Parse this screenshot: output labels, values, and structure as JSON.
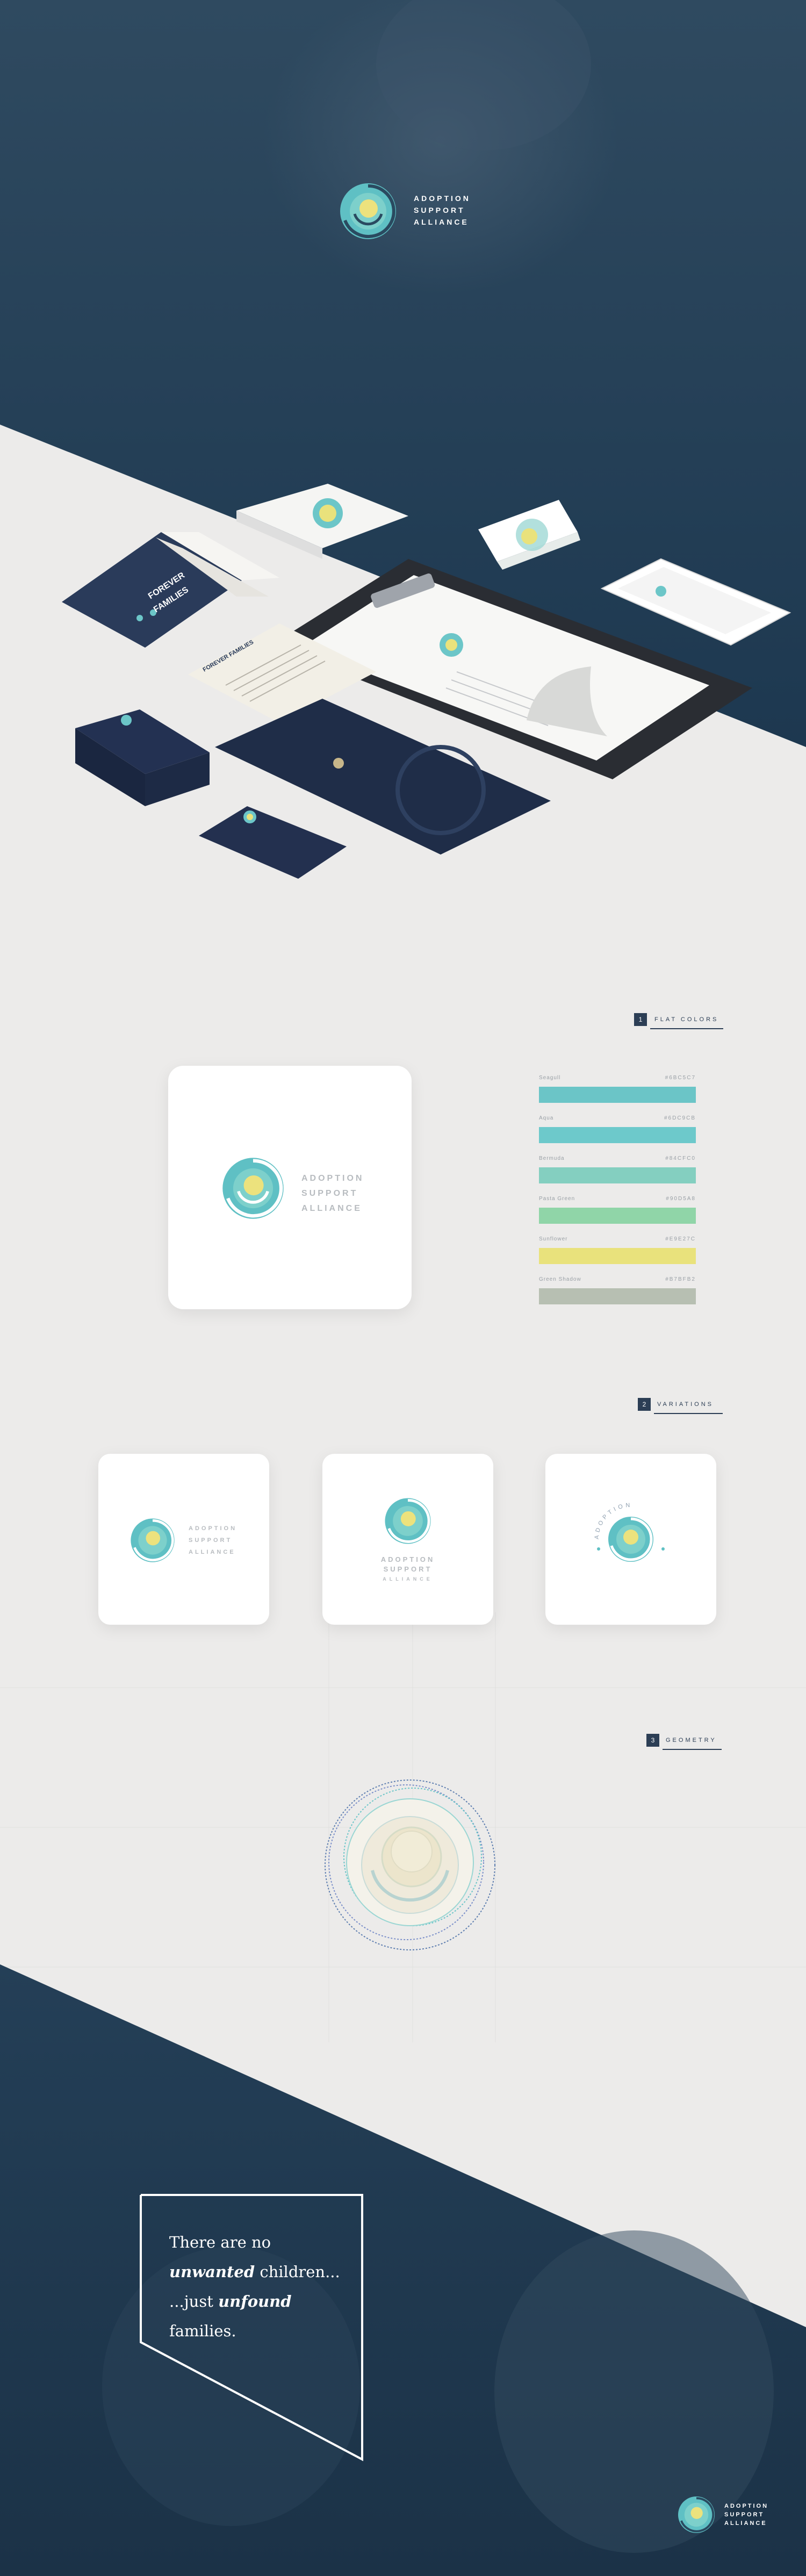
{
  "brand": {
    "line1": "ADOPTION",
    "line2": "SUPPORT",
    "line3": "ALLIANCE"
  },
  "colors": {
    "navy": "#1e3a52",
    "teal": "#6cc6c8",
    "mint": "#84cfc0",
    "yellow": "#e9e27c",
    "sage": "#b7bfb2"
  },
  "mockups": {
    "book_line1": "FOREVER",
    "book_line2": "FAMILIES",
    "folder_title": "FOREVER FAMILIES"
  },
  "sections": {
    "flat_colors": {
      "num": "1",
      "title": "FLAT COLORS"
    },
    "variations": {
      "num": "2",
      "title": "VARIATIONS"
    },
    "geometry": {
      "num": "3",
      "title": "GEOMETRY"
    }
  },
  "swatches": [
    {
      "name": "Seagull",
      "hex": "#6BC5C7",
      "color": "#6bc5c7"
    },
    {
      "name": "Aqua",
      "hex": "#6DC9CB",
      "color": "#6dc9cb"
    },
    {
      "name": "Bermuda",
      "hex": "#84CFC0",
      "color": "#84cfc0"
    },
    {
      "name": "Pasta Green",
      "hex": "#90D5A8",
      "color": "#90d5a8"
    },
    {
      "name": "Sunflower",
      "hex": "#E9E27C",
      "color": "#e9e27c"
    },
    {
      "name": "Green Shadow",
      "hex": "#B7BFB2",
      "color": "#b7bfb2"
    }
  ],
  "quote": {
    "line1": "There are no",
    "line2_em": "unwanted",
    "line2_rest": " children...",
    "line3_pre": "...just ",
    "line3_em": "unfound",
    "line3_rest": " families."
  }
}
